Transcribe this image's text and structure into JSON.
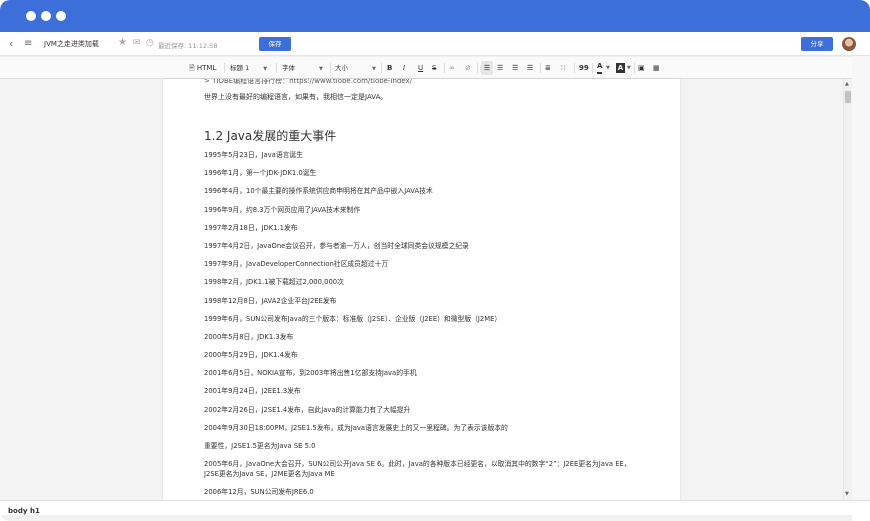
{
  "header": {
    "back_icon": "chevron-left-icon",
    "menu_icon": "hamburger-menu-icon",
    "doc_title": "JVM之走进类加载",
    "last_saved": "最近保存: 11:12:58",
    "save_label": "保存",
    "share_label": "分享"
  },
  "toolbar": {
    "source_label": "HTML",
    "heading_select": "标题 1",
    "font_select": "字体",
    "size_select": "大小",
    "bold": "B",
    "italic": "I",
    "underline": "U",
    "strike": "S",
    "quote": "99"
  },
  "content": {
    "cut_line": "> TIOBE编程语言排行榜：https://www.tiobe.com/tiobe-index/",
    "intro": "世界上没有最好的编程语言，如果有，我相信一定是JAVA。",
    "heading": "1.2 Java发展的重大事件",
    "paragraphs": [
      "1995年5月23日，Java语言诞生",
      "1996年1月，第一个JDK-JDK1.0诞生",
      "1996年4月，10个最主要的操作系统供应商申明将在其产品中嵌入JAVA技术",
      "1996年9月，约8.3万个网页应用了JAVA技术来制作",
      "1997年2月18日，JDK1.1发布",
      "1997年4月2日，JavaOne会议召开，参与者逾一万人，创当时全球同类会议规模之纪录",
      "1997年9月，JavaDeveloperConnection社区成员超过十万",
      "1998年2月，JDK1.1被下载超过2,000,000次",
      "1998年12月8日，JAVA2企业平台J2EE发布",
      "1999年6月，SUN公司发布Java的三个版本：标准版（J2SE）、企业版（J2EE）和微型版（J2ME）",
      "2000年5月8日，JDK1.3发布",
      "2000年5月29日，JDK1.4发布",
      "2001年6月5日，NOKIA宣布，到2003年将出售1亿部支持Java的手机",
      "2001年9月24日，J2EE1.3发布",
      "2002年2月26日，J2SE1.4发布，自此Java的计算能力有了大幅提升",
      "2004年9月30日18:00PM，J2SE1.5发布，成为Java语言发展史上的又一里程碑。为了表示该版本的",
      "重要性，J2SE1.5更名为Java SE 5.0",
      "2005年6月，JavaOne大会召开，SUN公司公开Java SE 6。此时，Java的各种版本已经更名，以取消其中的数字“2”：J2EE更名为Java EE，J2SE更名为Java SE，J2ME更名为Java ME",
      "2006年12月，SUN公司发布JRE6.0"
    ]
  },
  "statusbar": {
    "path": [
      "body",
      "h1"
    ]
  },
  "colors": {
    "accent": "#3c6fd9"
  }
}
